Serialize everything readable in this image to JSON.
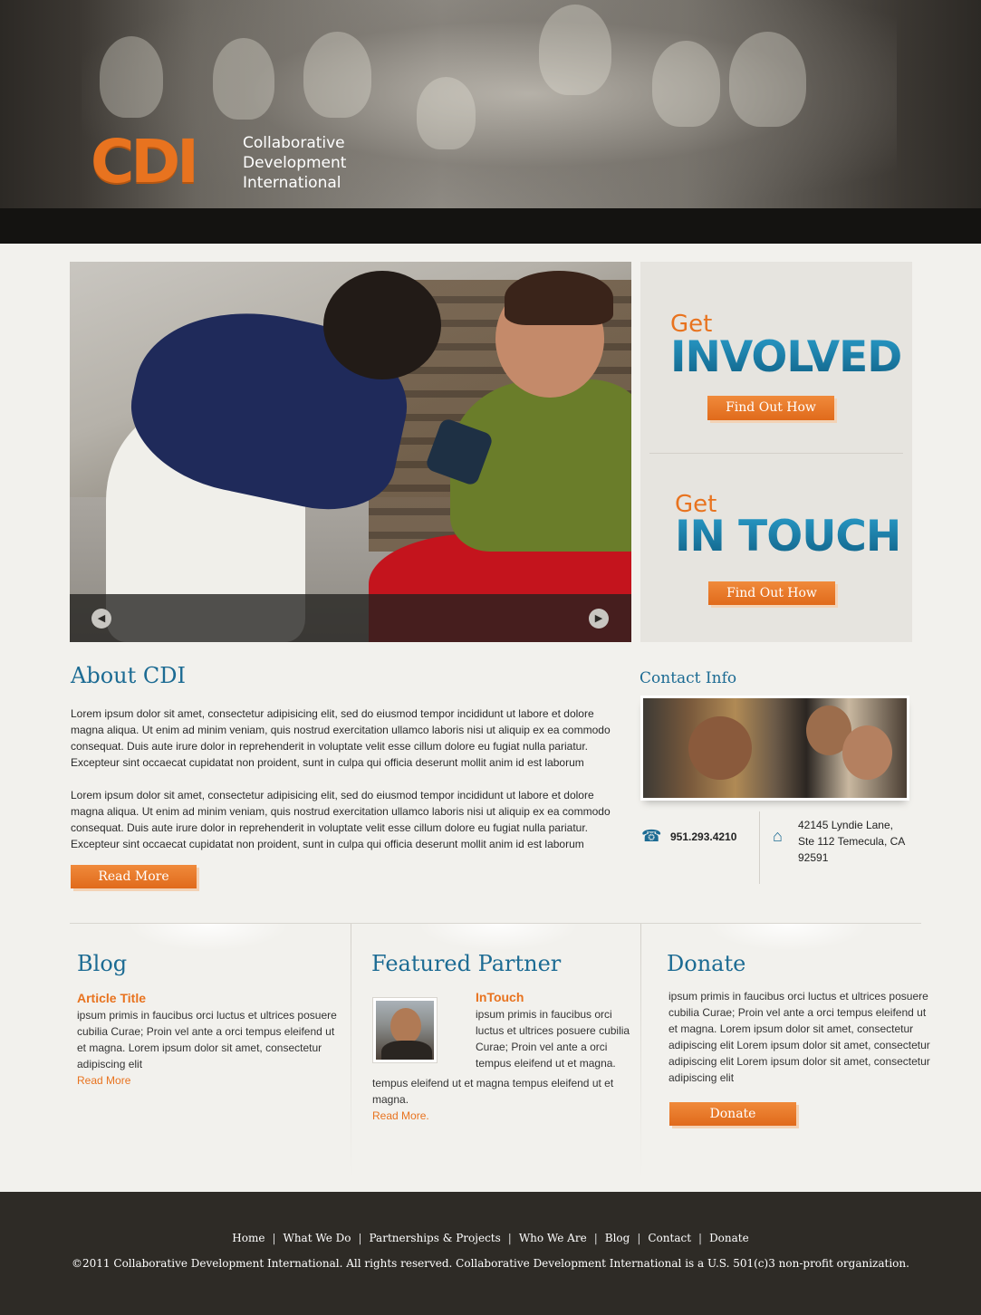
{
  "colors": {
    "accent": "#e8731f",
    "heading_blue": "#1c6b93",
    "footer_bg": "#2e2b26",
    "page_bg": "#f2f1ed"
  },
  "header": {
    "logo_mark": "CDI",
    "logo_words": [
      "Collaborative",
      "Development",
      "International"
    ]
  },
  "slider": {
    "prev_icon": "arrow-left-icon",
    "next_icon": "arrow-right-icon",
    "prev_glyph": "◀",
    "next_glyph": "▶"
  },
  "cta": {
    "involved": {
      "get": "Get",
      "big": "INVOLVED",
      "button": "Find Out How"
    },
    "touch": {
      "get": "Get",
      "big": "IN TOUCH",
      "button": "Find Out How"
    }
  },
  "about": {
    "title": "About CDI",
    "p1": "Lorem ipsum dolor sit amet, consectetur adipisicing elit, sed do eiusmod tempor incididunt ut labore et dolore magna aliqua. Ut enim ad minim veniam, quis nostrud exercitation ullamco laboris nisi ut aliquip ex ea commodo consequat. Duis aute irure dolor in reprehenderit in voluptate velit esse cillum dolore eu fugiat nulla pariatur. Excepteur sint occaecat cupidatat non proident, sunt in culpa qui officia deserunt mollit anim id est laborum",
    "p2": "Lorem ipsum dolor sit amet, consectetur adipisicing elit, sed do eiusmod tempor incididunt ut labore et dolore magna aliqua. Ut enim ad minim veniam, quis nostrud exercitation ullamco laboris nisi ut aliquip ex ea commodo consequat. Duis aute irure dolor in reprehenderit in voluptate velit esse cillum dolore eu fugiat nulla pariatur. Excepteur sint occaecat cupidatat non proident, sunt in culpa qui officia deserunt mollit anim id est laborum",
    "button": "Read More"
  },
  "contact": {
    "title": "Contact Info",
    "phone_icon": "phone-icon",
    "phone_glyph": "☎",
    "phone": "951.293.4210",
    "home_icon": "home-icon",
    "home_glyph": "⌂",
    "address_lines": [
      "42145 Lyndie Lane,",
      "Ste 112 Temecula, CA",
      "92591"
    ]
  },
  "blog": {
    "title": "Blog",
    "article_title": "Article Title",
    "text": "ipsum primis in faucibus orci luctus et ultrices posuere cubilia Curae; Proin vel ante a orci tempus eleifend ut et magna. Lorem ipsum dolor sit amet, consectetur adipiscing elit",
    "link": "Read More"
  },
  "partner": {
    "title": "Featured Partner",
    "name": "InTouch",
    "text_side": "ipsum primis in faucibus orci luctus et ultrices posuere cubilia Curae; Proin vel ante a orci tempus eleifend ut et magna.",
    "text_below": "tempus eleifend ut et magna tempus eleifend ut et magna.",
    "link": "Read More."
  },
  "donate": {
    "title": "Donate",
    "text": "ipsum primis in faucibus orci luctus et ultrices posuere cubilia Curae; Proin vel ante a orci tempus eleifend ut et magna. Lorem ipsum dolor sit amet, consectetur adipiscing elit Lorem ipsum dolor sit amet, consectetur adipiscing elit Lorem ipsum dolor sit amet, consectetur adipiscing elit",
    "button": "Donate"
  },
  "footer": {
    "nav": [
      "Home",
      "What We Do",
      "Partnerships & Projects",
      "Who We Are",
      "Blog",
      "Contact",
      "Donate"
    ],
    "separator": "|",
    "copyright": "©2011 Collaborative Development International. All rights reserved. Collaborative Development International is a U.S. 501(c)3 non-profit organization."
  }
}
